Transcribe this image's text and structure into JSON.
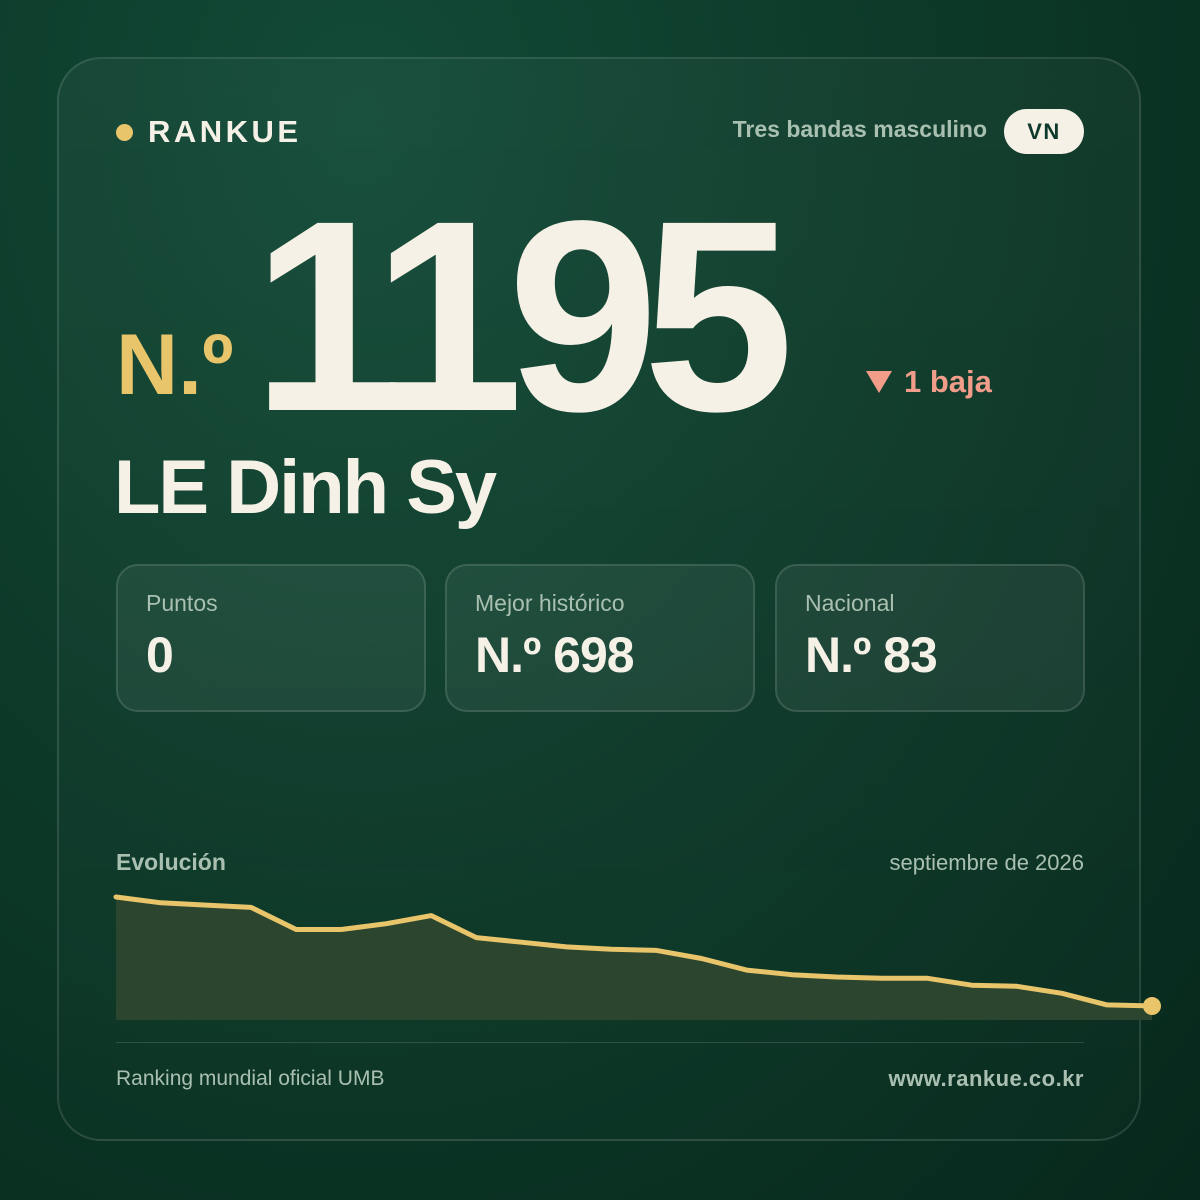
{
  "brand": {
    "name": "RANKUE"
  },
  "header": {
    "category": "Tres bandas masculino",
    "country_code": "VN"
  },
  "rank": {
    "prefix": "N.º",
    "value": "1195",
    "change_text": "1 baja",
    "change_direction": "down"
  },
  "player": {
    "name": "LE Dinh Sy"
  },
  "stats": [
    {
      "label": "Puntos",
      "value": "0"
    },
    {
      "label": "Mejor histórico",
      "value": "N.º 698"
    },
    {
      "label": "Nacional",
      "value": "N.º 83"
    }
  ],
  "chart": {
    "title": "Evolución",
    "date": "septiembre de 2026"
  },
  "chart_data": {
    "type": "area",
    "title": "Evolución",
    "y_axis": "rank",
    "values": [
      1,
      0.95,
      0.93,
      0.91,
      0.72,
      0.72,
      0.77,
      0.84,
      0.65,
      0.61,
      0.57,
      0.55,
      0.54,
      0.47,
      0.37,
      0.33,
      0.31,
      0.3,
      0.3,
      0.24,
      0.23,
      0.17,
      0.07,
      0.06
    ],
    "values_note": "",
    "grid": false,
    "legend": "none"
  },
  "footer": {
    "source": "Ranking mundial oficial UMB",
    "url": "www.rankue.co.kr"
  },
  "colors": {
    "accent": "#e8c46a",
    "down": "#f19d8a",
    "background": "#0d3a29",
    "text": "#f6f1e6",
    "muted": "#a9c0b1"
  }
}
